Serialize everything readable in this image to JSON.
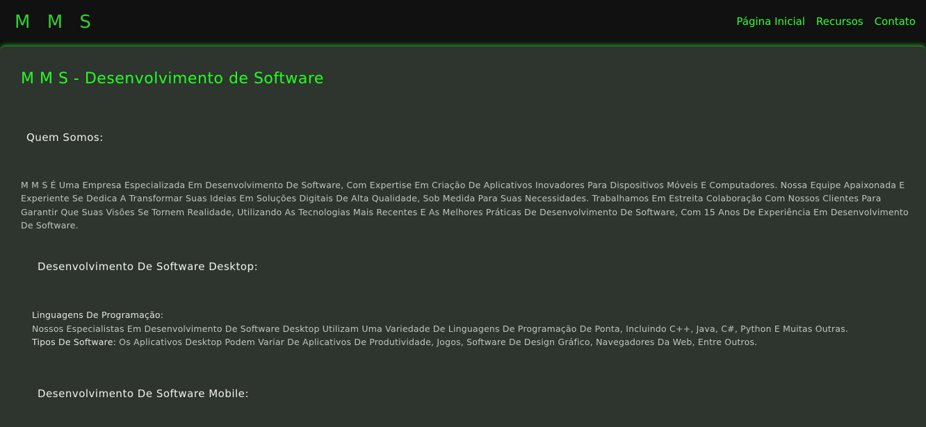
{
  "header": {
    "logo": "M M S",
    "nav": {
      "home": "Página Inicial",
      "resources": "Recursos",
      "contact": "Contato"
    }
  },
  "main": {
    "title": "M M S - Desenvolvimento de Software",
    "about_heading": "Quem Somos:",
    "about_text": "M M S É Uma Empresa Especializada Em Desenvolvimento De Software, Com Expertise Em Criação De Aplicativos Inovadores Para Dispositivos Móveis E Computadores. Nossa Equipe Apaixonada E Experiente Se Dedica A Transformar Suas Ideias Em Soluções Digitais De Alta Qualidade, Sob Medida Para Suas Necessidades. Trabalhamos Em Estreita Colaboração Com Nossos Clientes Para Garantir Que Suas Visões Se Tornem Realidade, Utilizando As Tecnologias Mais Recentes E As Melhores Práticas De Desenvolvimento De Software, Com 15 Anos De Experiência Em Desenvolvimento De Software.",
    "desktop": {
      "heading": "Desenvolvimento De Software Desktop:",
      "languages_label": "Linguagens De Programação:",
      "languages_text": "Nossos Especialistas Em Desenvolvimento De Software Desktop Utilizam Uma Variedade De Linguagens De Programação De Ponta, Incluindo C++, Java, C#, Python E Muitas Outras.",
      "types_label": "Tipos De Software:",
      "types_text": " Os Aplicativos Desktop Podem Variar De Aplicativos De Produtividade, Jogos, Software De Design Gráfico, Navegadores Da Web, Entre Outros."
    },
    "mobile": {
      "heading": "Desenvolvimento De Software Mobile:"
    }
  },
  "colors": {
    "accent": "#22ff22",
    "header_bg": "#111111",
    "content_bg": "#2e342e"
  }
}
